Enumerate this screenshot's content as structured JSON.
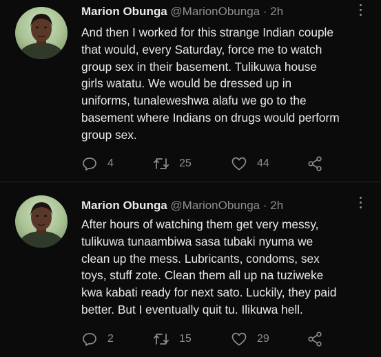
{
  "colors": {
    "background": "#0b0b0b",
    "text_primary": "#e7e9ea",
    "text_secondary": "#8b8f93",
    "divider": "#2a2d30"
  },
  "tweets": [
    {
      "name": "Marion Obunga",
      "handle": "@MarionObunga",
      "separator": "·",
      "time": "2h",
      "lines": [
        "And then I worked for this strange Indian couple",
        "that would, every Saturday, force me to watch",
        "group sex in their basement. Tulikuwa house",
        "girls watatu. We would be dressed up in",
        "uniforms, tunaleweshwa alafu we go to the",
        "basement where Indians on drugs would perform",
        "group sex."
      ],
      "replies": "4",
      "retweets": "25",
      "likes": "44",
      "icons": [
        "reply-icon",
        "retweet-icon",
        "heart-icon",
        "share-icon",
        "more-icon"
      ]
    },
    {
      "name": "Marion Obunga",
      "handle": "@MarionObunga",
      "separator": "·",
      "time": "2h",
      "lines": [
        "After hours of watching them get very messy,",
        "tulikuwa tunaambiwa sasa tubaki nyuma we",
        "clean up the mess. Lubricants, condoms, sex",
        "toys, stuff zote. Clean them all up na tuziweke",
        "kwa kabati ready for next sato. Luckily, they paid",
        "better. But I eventually quit tu. Ilikuwa hell."
      ],
      "replies": "2",
      "retweets": "15",
      "likes": "29",
      "icons": [
        "reply-icon",
        "retweet-icon",
        "heart-icon",
        "share-icon",
        "more-icon"
      ]
    }
  ]
}
